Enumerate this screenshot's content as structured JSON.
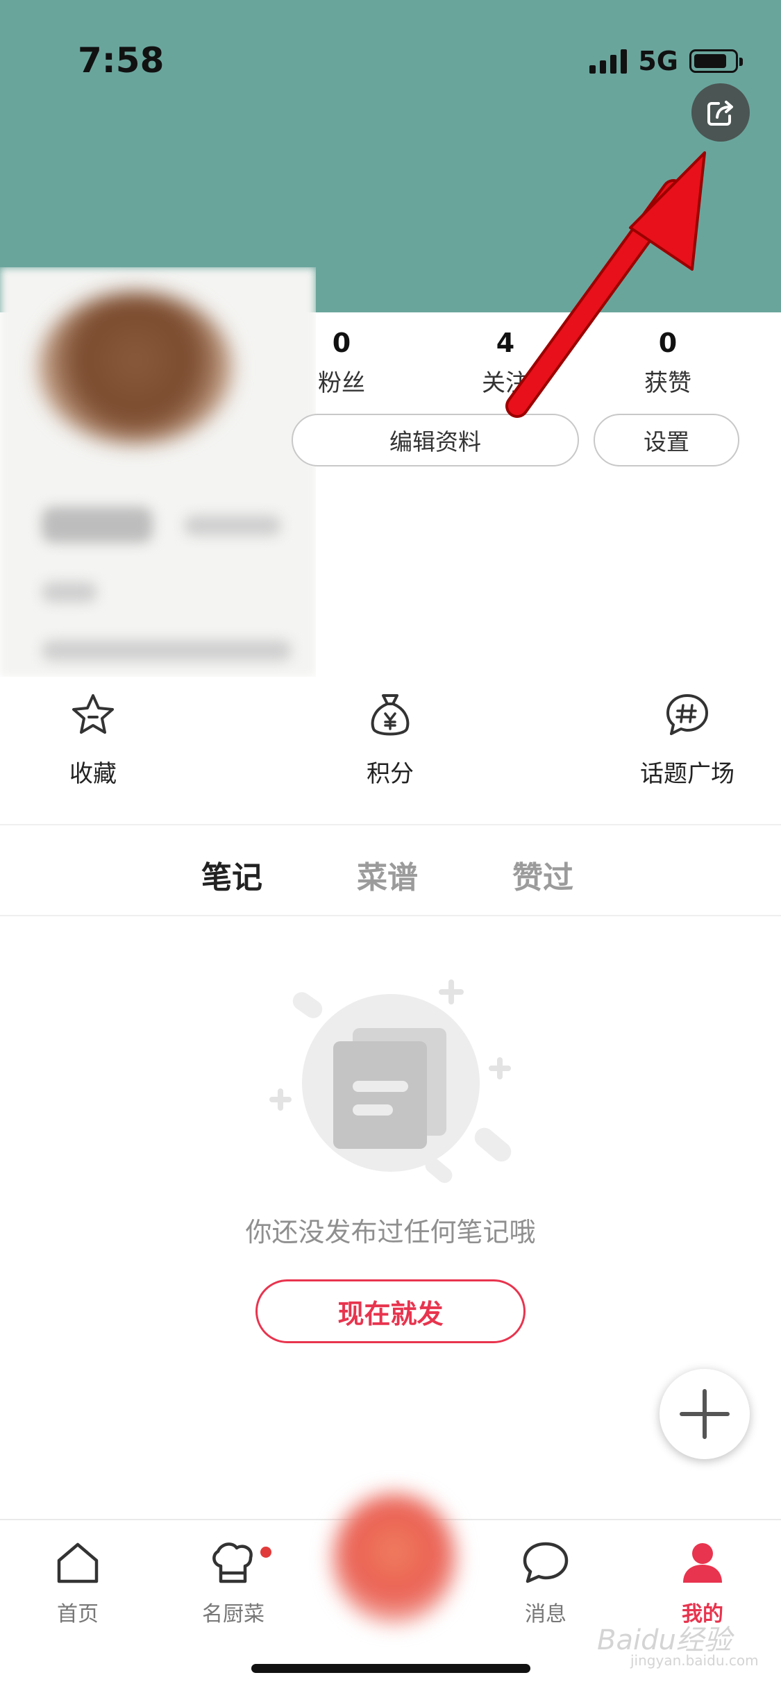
{
  "status_bar": {
    "time": "7:58",
    "network": "5G"
  },
  "header": {
    "share_icon": "share-icon",
    "band_color": "#6aa59c"
  },
  "stats": [
    {
      "value": "0",
      "label": "粉丝"
    },
    {
      "value": "4",
      "label": "关注"
    },
    {
      "value": "0",
      "label": "获赞"
    }
  ],
  "profile_actions": {
    "edit_label": "编辑资料",
    "settings_label": "设置"
  },
  "quick_links": [
    {
      "icon": "star-icon",
      "label": "收藏"
    },
    {
      "icon": "money-bag-icon",
      "label": "积分"
    },
    {
      "icon": "hashtag-bubble-icon",
      "label": "话题广场"
    }
  ],
  "tabs": [
    {
      "label": "笔记",
      "active": true
    },
    {
      "label": "菜谱",
      "active": false
    },
    {
      "label": "赞过",
      "active": false
    }
  ],
  "empty_state": {
    "message": "你还没发布过任何笔记哦",
    "button_label": "现在就发"
  },
  "bottom_nav": [
    {
      "icon": "home-icon",
      "label": "首页",
      "active": false
    },
    {
      "icon": "chef-hat-icon",
      "label": "名厨菜",
      "active": false,
      "badge": true
    },
    {
      "icon": "chat-bubble-icon",
      "label": "消息",
      "active": false
    },
    {
      "icon": "user-icon",
      "label": "我的",
      "active": true
    }
  ],
  "watermark": {
    "text": "Baidu经验",
    "sub": "jingyan.baidu.com"
  },
  "colors": {
    "accent": "#e8344e",
    "header": "#6aa59c",
    "arrow": "#e8101a"
  }
}
